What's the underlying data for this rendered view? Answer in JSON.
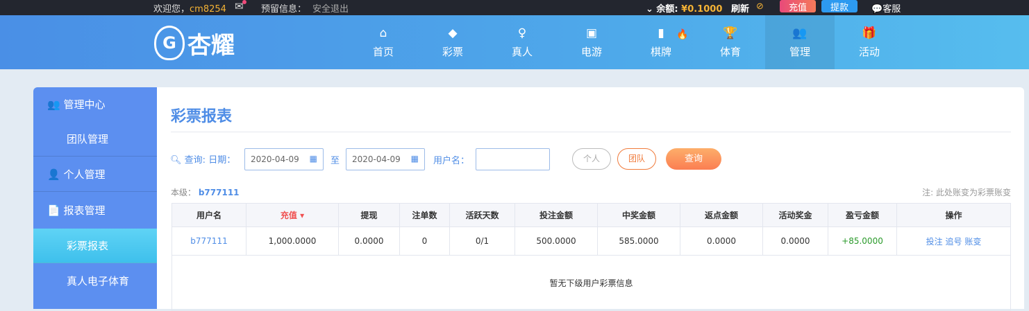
{
  "topbar": {
    "welcome": "欢迎您，",
    "username": "cm8254",
    "reserved": "预留信息：",
    "logout": "安全退出",
    "balance_label": "余额:",
    "balance": "¥0.1000",
    "refresh": "刷新",
    "deposit": "充值",
    "withdraw": "提款",
    "service": "客服"
  },
  "logo": {
    "text": "杏耀"
  },
  "nav": [
    {
      "label": "首页",
      "icon": "⌂"
    },
    {
      "label": "彩票",
      "icon": "◆"
    },
    {
      "label": "真人",
      "icon": "♀"
    },
    {
      "label": "电游",
      "icon": "▣"
    },
    {
      "label": "棋牌",
      "icon": "▮"
    },
    {
      "label": "体育",
      "icon": "🏆"
    },
    {
      "label": "管理",
      "icon": "👥"
    },
    {
      "label": "活动",
      "icon": "🎁"
    }
  ],
  "sidebar": [
    {
      "label": "管理中心"
    },
    {
      "label": "团队管理"
    },
    {
      "label": "个人管理"
    },
    {
      "label": "报表管理"
    },
    {
      "label": "彩票报表"
    },
    {
      "label": "真人电子体育"
    }
  ],
  "main": {
    "title": "彩票报表",
    "query_label": "查询:",
    "date_label": "日期：",
    "date_from": "2020-04-09",
    "to": "至",
    "date_to": "2020-04-09",
    "user_label": "用户名：",
    "user_value": "",
    "btn_personal": "个人",
    "btn_team": "团队",
    "btn_query": "查询",
    "level_label": "本级：",
    "level_user": "b777111",
    "note": "注: 此处账变为彩票账变"
  },
  "table": {
    "headers": [
      "用户名",
      "充值",
      "提现",
      "注单数",
      "活跃天数",
      "投注金额",
      "中奖金额",
      "返点金额",
      "活动奖金",
      "盈亏金额",
      "操作"
    ],
    "row": [
      "b777111",
      "1,000.0000",
      "0.0000",
      "0",
      "0/1",
      "500.0000",
      "585.0000",
      "0.0000",
      "0.0000",
      "+85.0000"
    ],
    "actions": [
      "投注",
      "追号",
      "账变"
    ],
    "empty": "暂无下级用户彩票信息"
  }
}
